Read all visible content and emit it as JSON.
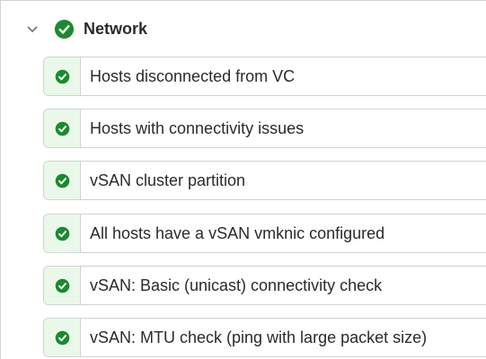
{
  "group": {
    "title": "Network",
    "status_icon": "success-check-icon",
    "expand_icon": "chevron-down-icon",
    "status_color": "#1b8a2f"
  },
  "checks": [
    {
      "label": "Hosts disconnected from VC",
      "status": "passed"
    },
    {
      "label": "Hosts with connectivity issues",
      "status": "passed"
    },
    {
      "label": "vSAN cluster partition",
      "status": "passed"
    },
    {
      "label": "All hosts have a vSAN vmknic configured",
      "status": "passed"
    },
    {
      "label": "vSAN: Basic (unicast) connectivity check",
      "status": "passed"
    },
    {
      "label": "vSAN: MTU check (ping with large packet size)",
      "status": "passed"
    }
  ]
}
